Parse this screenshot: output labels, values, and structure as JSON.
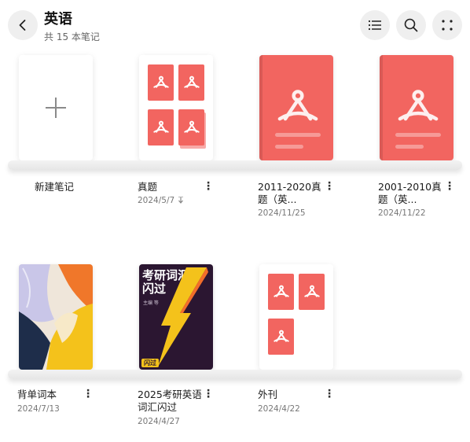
{
  "header": {
    "title": "英语",
    "subtitle": "共 15 本笔记"
  },
  "icons": {
    "back": "chevron-left-icon",
    "list": "list-icon",
    "search": "search-icon",
    "more": "four-dots-icon",
    "more_options": "more-vertical-icon"
  },
  "colors": {
    "pdf_red": "#f26560",
    "accent_yellow": "#f4c21b",
    "dark_purple": "#2b1631"
  },
  "notebooks": [
    {
      "label": "新建笔记",
      "date": ""
    },
    {
      "label": "真题",
      "date": "2024/5/7",
      "pinned": true
    },
    {
      "label": "2011-2020真题（英...",
      "date": "2024/11/25"
    },
    {
      "label": "2001-2010真题（英...",
      "date": "2024/11/22"
    },
    {
      "label": "背单词本",
      "date": "2024/7/13"
    },
    {
      "label": "2025考研英语词汇闪过",
      "date": "2024/4/27"
    },
    {
      "label": "外刊",
      "date": "2024/4/22"
    }
  ],
  "cover_vocab": {
    "title_line1": "考研词汇",
    "title_line2": "闪过",
    "small_text": "主编 等",
    "badge": "闪过"
  }
}
